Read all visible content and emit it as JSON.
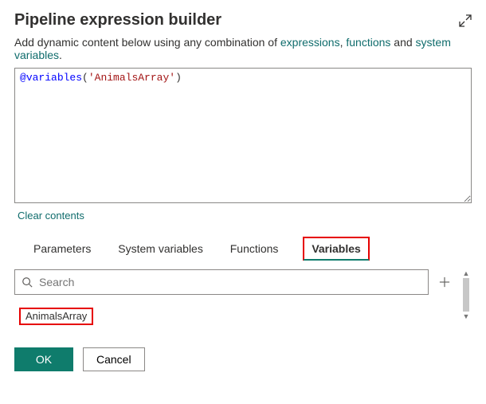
{
  "header": {
    "title": "Pipeline expression builder"
  },
  "subtext": {
    "prefix": "Add dynamic content below using any combination of ",
    "link_expressions": "expressions",
    "sep1": ", ",
    "link_functions": "functions",
    "sep2": " and ",
    "link_sysvars": "system variables",
    "suffix": "."
  },
  "editor": {
    "at": "@",
    "fn": "variables",
    "open": "(",
    "arg": "'AnimalsArray'",
    "close": ")"
  },
  "links": {
    "clear": "Clear contents"
  },
  "tabs": {
    "parameters": "Parameters",
    "system_variables": "System variables",
    "functions": "Functions",
    "variables": "Variables"
  },
  "search": {
    "placeholder": "Search"
  },
  "variables": {
    "items": [
      "AnimalsArray"
    ]
  },
  "footer": {
    "ok": "OK",
    "cancel": "Cancel"
  }
}
